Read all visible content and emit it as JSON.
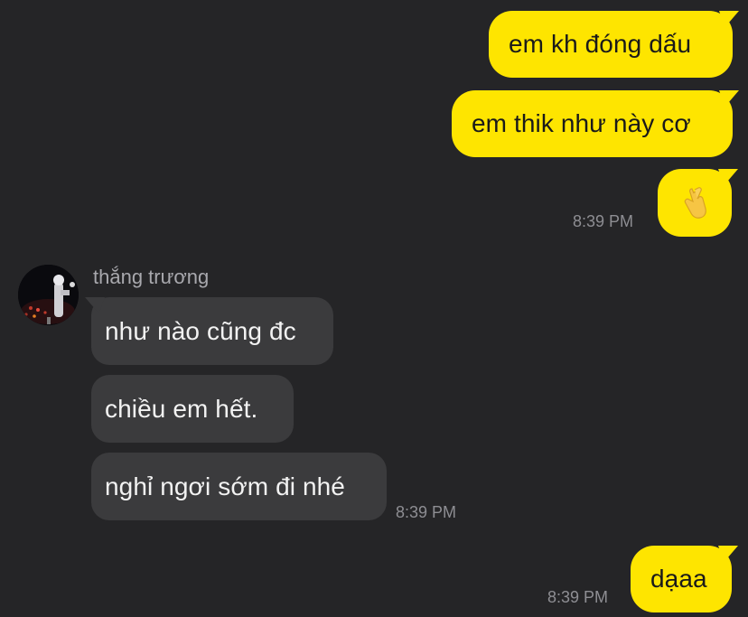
{
  "conversation": {
    "outgoing": [
      {
        "text": "em kh đóng dấu"
      },
      {
        "text": "em thik như này cơ"
      },
      {
        "emoji": "🤞",
        "icon": "crossed-fingers-hand-icon"
      },
      {
        "text": "dạaa"
      }
    ],
    "incoming": {
      "sender_name": "thắng trương",
      "messages": [
        {
          "text": "như nào cũng đc"
        },
        {
          "text": "chiều em hết."
        },
        {
          "text": "nghỉ ngơi sớm đi nhé"
        }
      ]
    },
    "timestamps": {
      "outgoing_group_1": "8:39 PM",
      "incoming_group": "8:39 PM",
      "outgoing_group_2": "8:39 PM"
    }
  },
  "colors": {
    "background": "#252527",
    "outgoing_bubble": "#FEE500",
    "incoming_bubble": "#3B3B3D",
    "timestamp": "#8E8E93"
  }
}
